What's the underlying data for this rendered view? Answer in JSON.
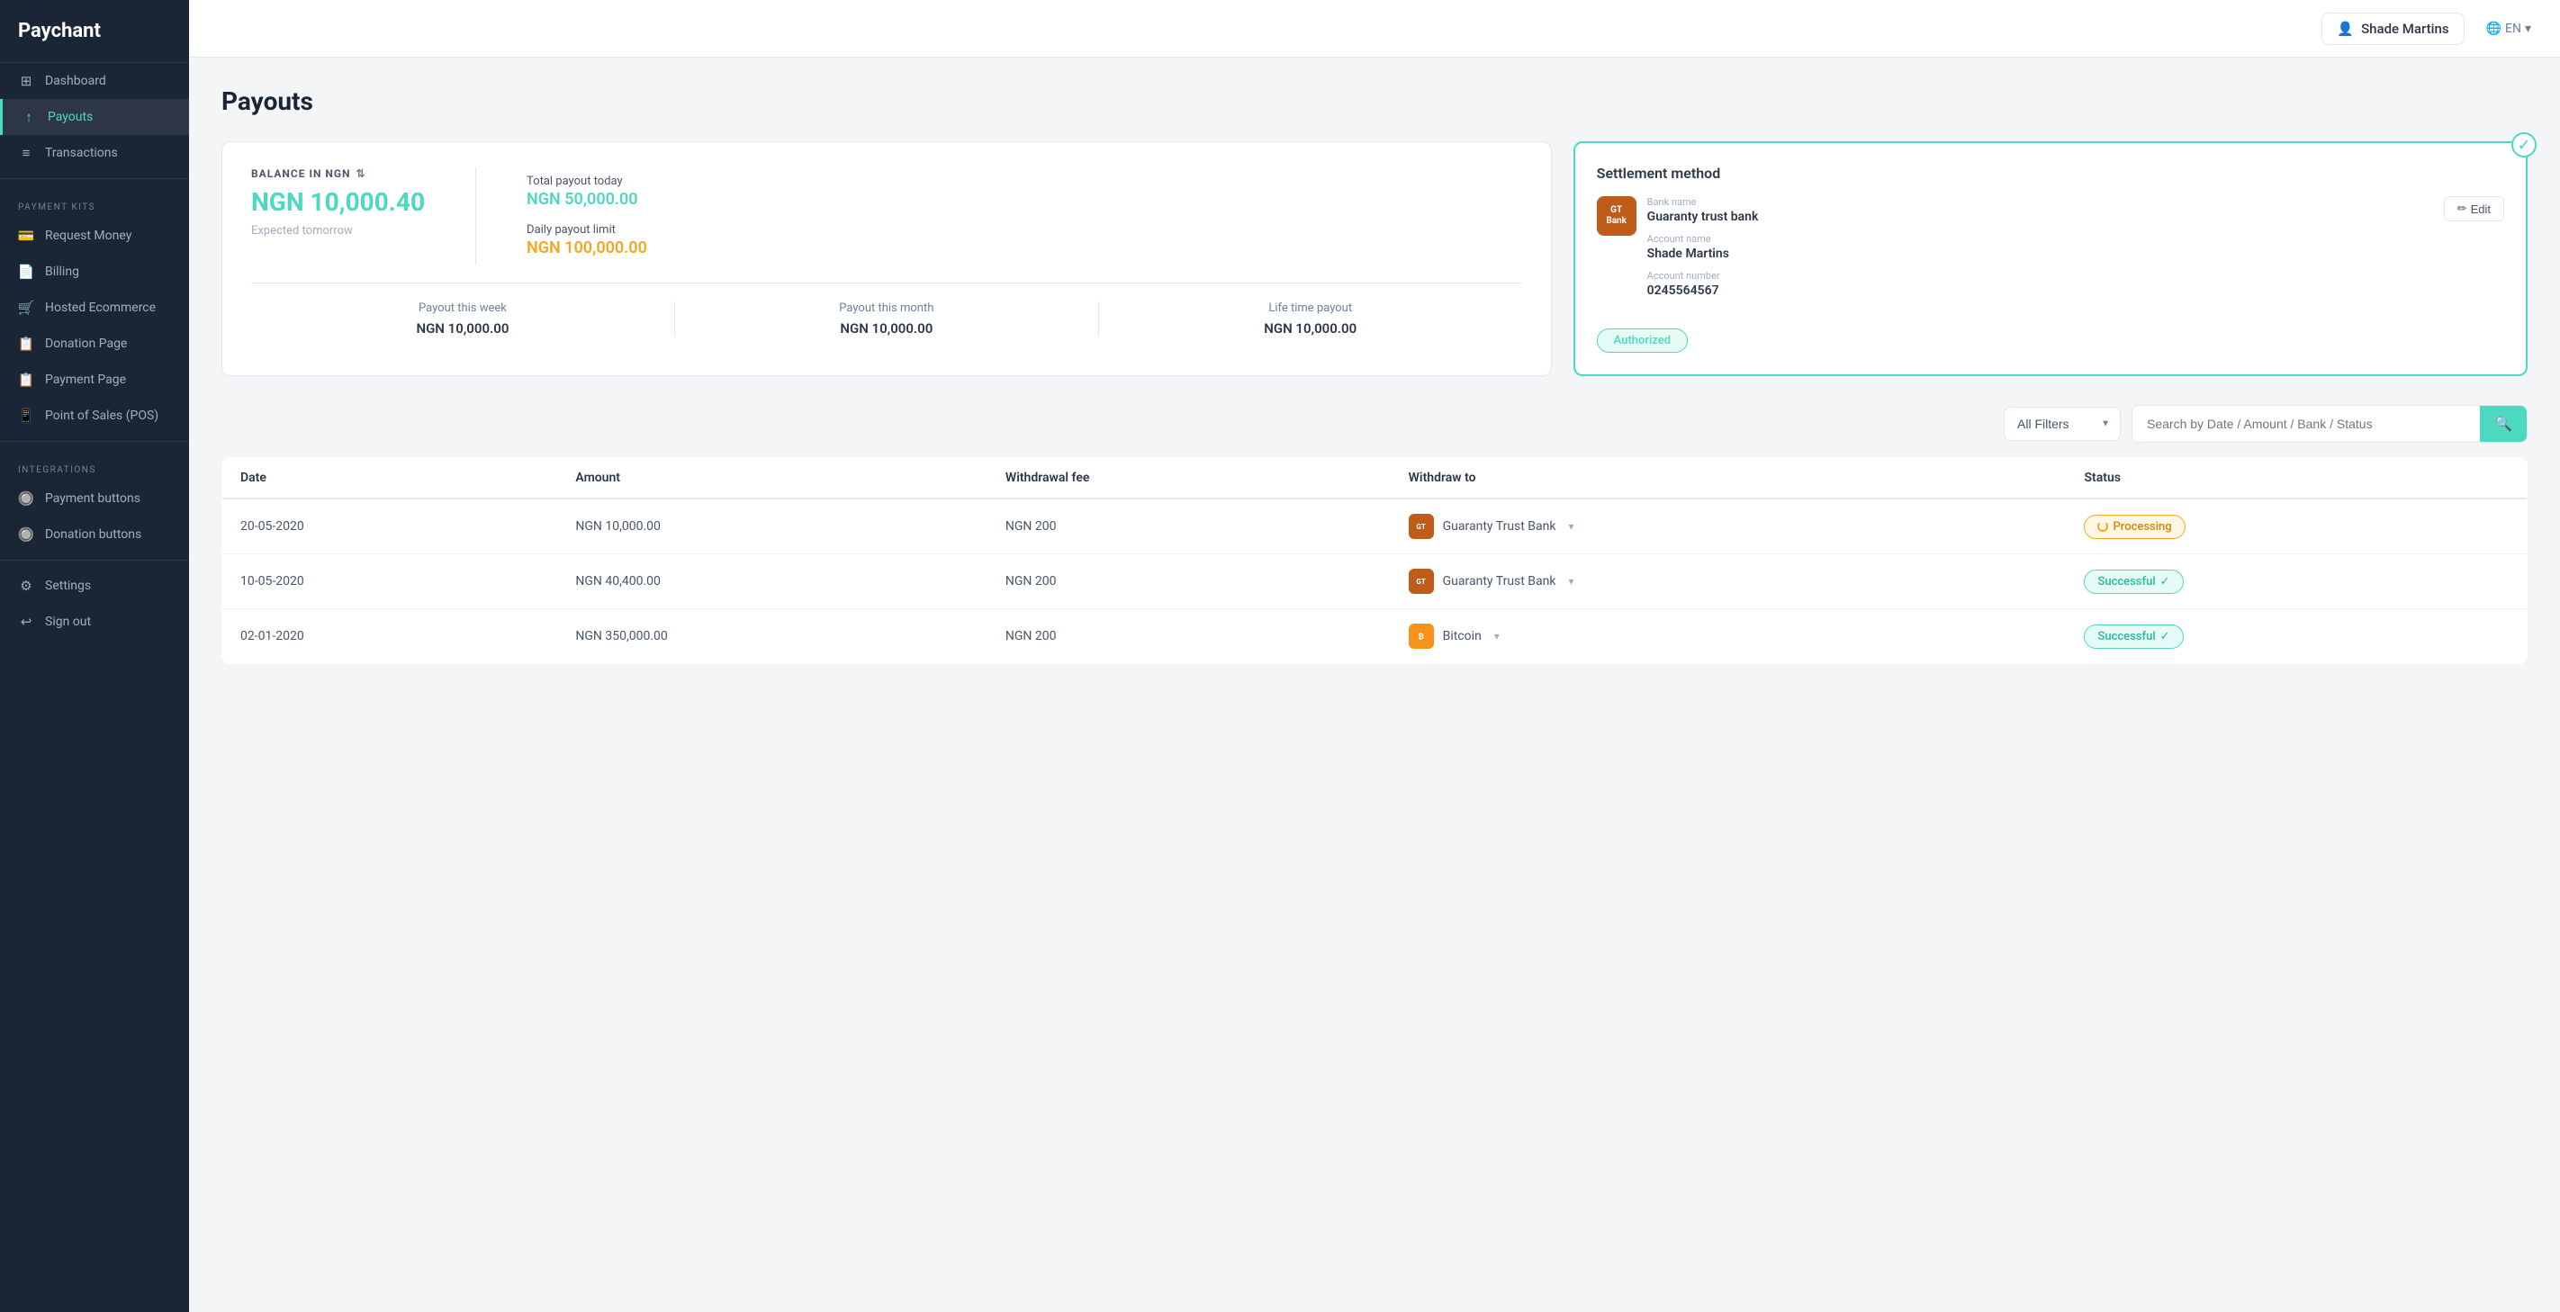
{
  "brand": {
    "name": "Paychant"
  },
  "user": {
    "name": "Shade Martins"
  },
  "lang": {
    "code": "EN"
  },
  "sidebar": {
    "nav_label": "",
    "items": [
      {
        "id": "dashboard",
        "label": "Dashboard",
        "icon": "⊞",
        "active": false
      },
      {
        "id": "payouts",
        "label": "Payouts",
        "icon": "↑",
        "active": true
      }
    ],
    "transactions": {
      "label": "Transactions",
      "icon": "≡"
    },
    "payment_kits_label": "PAYMENT KITS",
    "kits": [
      {
        "id": "request-money",
        "label": "Request Money",
        "icon": "💳"
      },
      {
        "id": "billing",
        "label": "Billing",
        "icon": "📄"
      },
      {
        "id": "hosted-ecommerce",
        "label": "Hosted Ecommerce",
        "icon": "🛒"
      },
      {
        "id": "donation-page",
        "label": "Donation Page",
        "icon": "📋"
      },
      {
        "id": "payment-page",
        "label": "Payment Page",
        "icon": "📋"
      },
      {
        "id": "point-of-sales",
        "label": "Point of Sales (POS)",
        "icon": "📱"
      }
    ],
    "integrations_label": "INTEGRATIONS",
    "integrations": [
      {
        "id": "payment-buttons",
        "label": "Payment buttons",
        "icon": "🔘"
      },
      {
        "id": "donation-buttons",
        "label": "Donation buttons",
        "icon": "🔘"
      }
    ],
    "settings": {
      "label": "Settings",
      "icon": "⚙"
    },
    "signout": {
      "label": "Sign out",
      "icon": "↩"
    }
  },
  "page": {
    "title": "Payouts"
  },
  "balance": {
    "label": "BALANCE IN NGN",
    "amount": "NGN 10,000.40",
    "expected_tomorrow": "Expected tomorrow",
    "total_payout_today_label": "Total payout today",
    "total_payout_today_value": "NGN 50,000.00",
    "daily_limit_label": "Daily payout limit",
    "daily_limit_value": "NGN 100,000.00",
    "payout_week_label": "Payout this week",
    "payout_week_value": "NGN 10,000.00",
    "payout_month_label": "Payout this month",
    "payout_month_value": "NGN 10,000.00",
    "lifetime_label": "Life time payout",
    "lifetime_value": "NGN 10,000.00"
  },
  "settlement": {
    "title": "Settlement method",
    "bank_name_label": "Bank name",
    "bank_name": "Guaranty trust bank",
    "bank_logo_text": "GT Bank",
    "account_name_label": "Account name",
    "account_name": "Shade Martins",
    "account_number_label": "Account number",
    "account_number": "0245564567",
    "edit_label": "Edit",
    "authorized_label": "Authorized"
  },
  "table": {
    "filter_label": "All Filters",
    "search_placeholder": "Search by Date / Amount / Bank / Status",
    "columns": [
      "Date",
      "Amount",
      "Withdrawal fee",
      "Withdraw to",
      "Status"
    ],
    "rows": [
      {
        "date": "20-05-2020",
        "amount": "NGN 10,000.00",
        "fee": "NGN 200",
        "bank": "Guaranty Trust Bank",
        "bank_type": "gt",
        "status": "Processing",
        "status_type": "processing"
      },
      {
        "date": "10-05-2020",
        "amount": "NGN 40,400.00",
        "fee": "NGN 200",
        "bank": "Guaranty Trust Bank",
        "bank_type": "gt",
        "status": "Successful",
        "status_type": "successful"
      },
      {
        "date": "02-01-2020",
        "amount": "NGN 350,000.00",
        "fee": "NGN 200",
        "bank": "Bitcoin",
        "bank_type": "btc",
        "status": "Successful",
        "status_type": "successful"
      }
    ]
  }
}
